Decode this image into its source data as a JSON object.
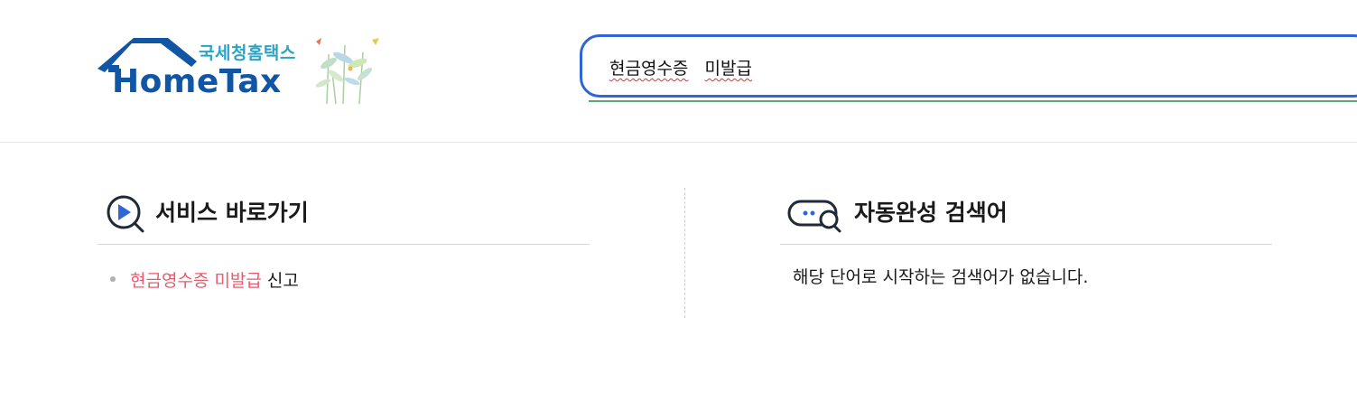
{
  "header": {
    "logo": {
      "korean_name": "국세청홈택스",
      "english_name": "HomeTax"
    },
    "search": {
      "value_part1": "현금영수증",
      "value_part2": "미발급",
      "accent_color": "#2e66d8"
    }
  },
  "service_shortcut": {
    "title": "서비스 바로가기",
    "icon": "play-magnifier-icon",
    "items": [
      {
        "highlight": "현금영수증 미발급",
        "rest": " 신고"
      }
    ],
    "highlight_color": "#e85a6f"
  },
  "autocomplete": {
    "title": "자동완성 검색어",
    "icon": "chat-search-icon",
    "empty_message": "해당 단어로 시작하는 검색어가 없습니다."
  }
}
